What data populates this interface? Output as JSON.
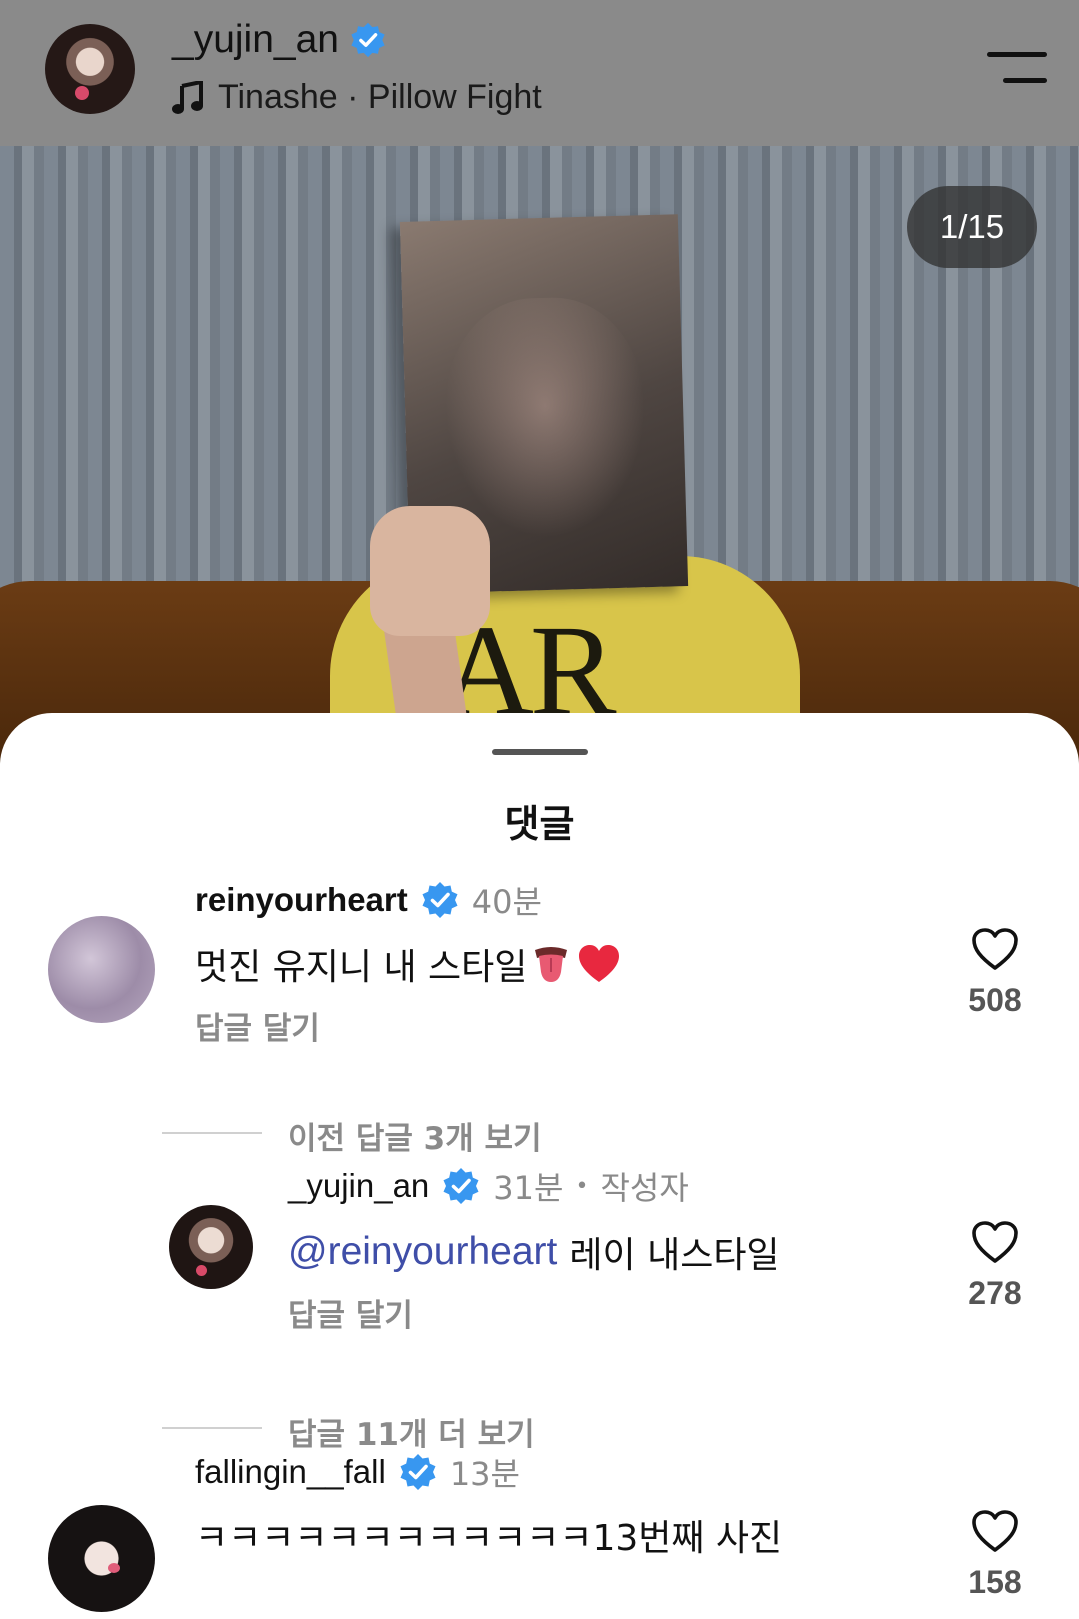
{
  "header": {
    "username": "_yujin_an",
    "music": "Tinashe · Pillow Fight"
  },
  "post": {
    "page_counter": "1/15",
    "shirt_text": "AR"
  },
  "sheet": {
    "title": "댓글"
  },
  "comments": [
    {
      "username": "reinyourheart",
      "time": "40분",
      "text": "멋진 유지니 내 스타일",
      "reply_label": "답글 달기",
      "likes": "508"
    },
    {
      "username": "_yujin_an",
      "time": "31분",
      "author_badge": "작성자",
      "mention": "@reinyourheart",
      "text": "레이 내스타일",
      "reply_label": "답글 달기",
      "likes": "278"
    },
    {
      "username": "fallingin__fall",
      "time": "13분",
      "text": "ㅋㅋㅋㅋㅋㅋㅋㅋㅋㅋㅋㅋ13번째 사진",
      "likes": "158"
    }
  ],
  "threads": {
    "previous_replies": "이전 답글 3개 보기",
    "more_replies": "답글 11개 더 보기"
  },
  "colors": {
    "header_bg": "#8a8a8a",
    "verified": "#3897f0",
    "mention": "#3f4ea8"
  }
}
